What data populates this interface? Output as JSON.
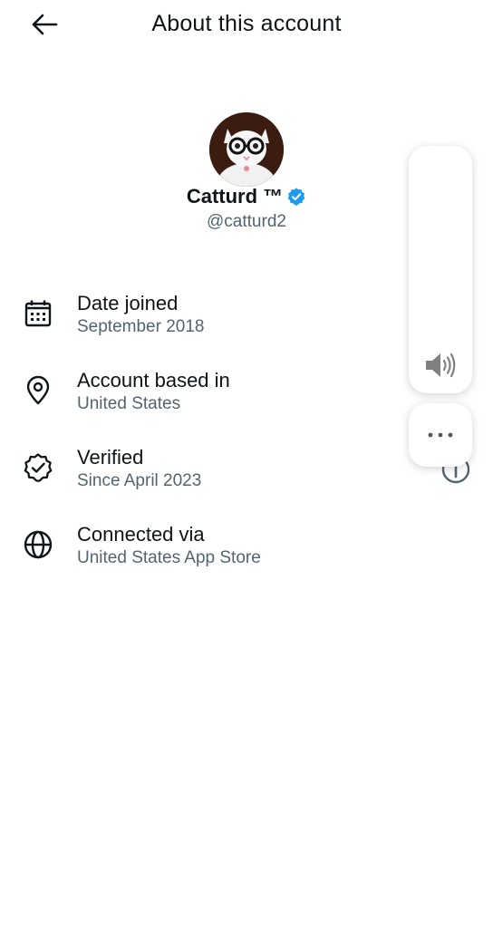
{
  "header": {
    "title": "About this account",
    "back_icon": "arrow-left-icon"
  },
  "profile": {
    "display_name": "Catturd ™",
    "handle": "@catturd2",
    "verified": true,
    "badge_color": "#1d9bf0"
  },
  "items": [
    {
      "icon": "calendar-icon",
      "title": "Date joined",
      "value": "September 2018"
    },
    {
      "icon": "location-pin-icon",
      "title": "Account based in",
      "value": "United States"
    },
    {
      "icon": "verified-check-icon",
      "title": "Verified",
      "value": "Since April 2023"
    },
    {
      "icon": "globe-icon",
      "title": "Connected via",
      "value": "United States App Store"
    }
  ],
  "overlay": {
    "volume_icon": "speaker-volume-icon",
    "more_icon": "more-dots-icon"
  },
  "colors": {
    "text_primary": "#0f1419",
    "text_secondary": "#536471"
  }
}
